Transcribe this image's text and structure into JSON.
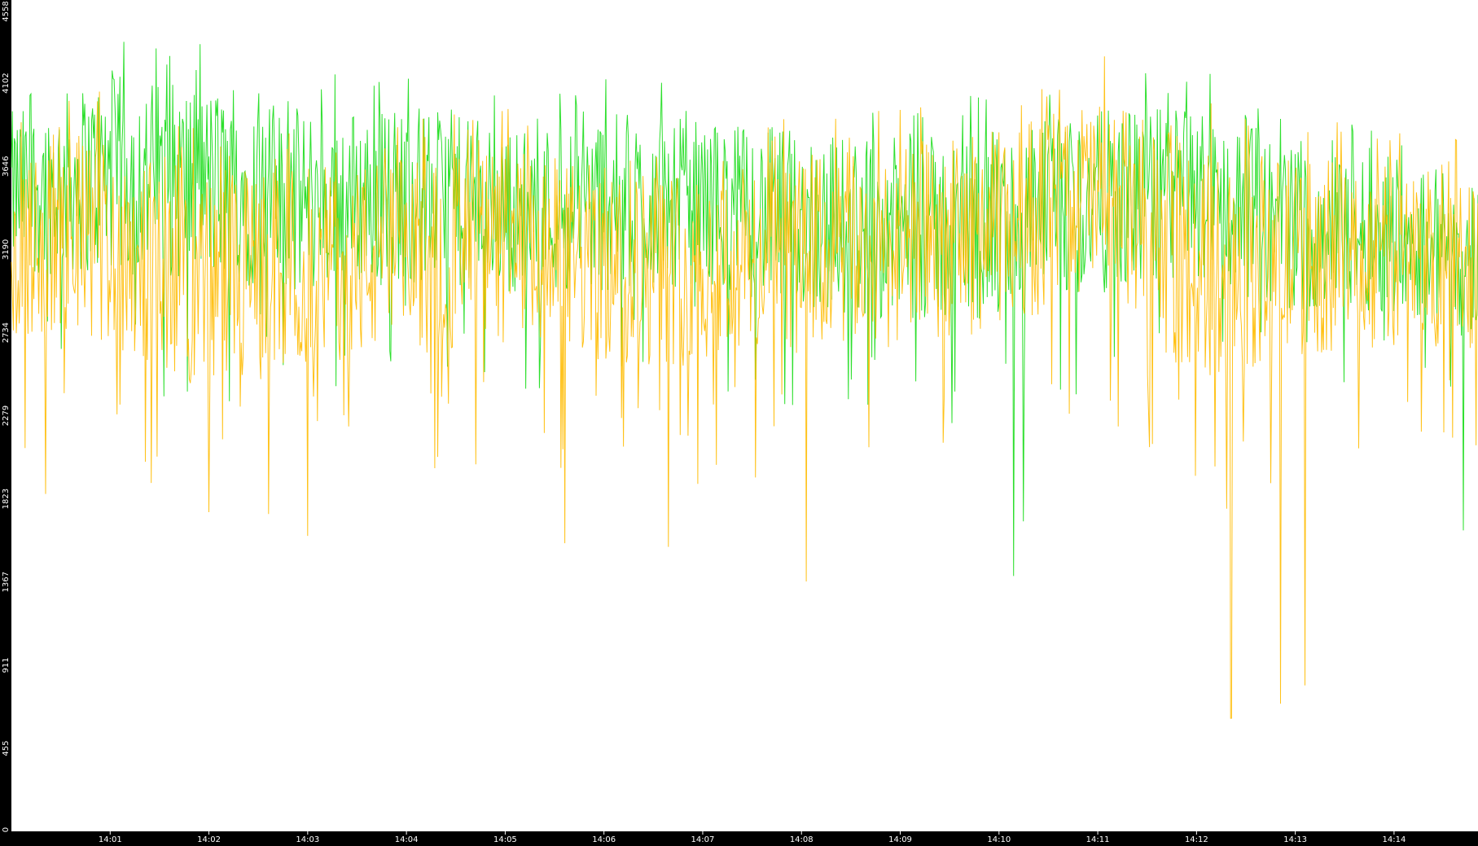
{
  "chart_data": {
    "type": "line",
    "title": "",
    "xlabel": "",
    "ylabel": "",
    "background": "#000000",
    "plot_background": "#ffffff",
    "grid": false,
    "legend": "none",
    "ylim": [
      0,
      4558
    ],
    "yticks": [
      0,
      455,
      911,
      1367,
      1823,
      2279,
      2734,
      3190,
      3646,
      4102,
      4558
    ],
    "xlim_minutes": [
      0,
      14.85
    ],
    "xticks": [
      {
        "label": "14:01",
        "minute": 1
      },
      {
        "label": "14:02",
        "minute": 2
      },
      {
        "label": "14:03",
        "minute": 3
      },
      {
        "label": "14:04",
        "minute": 4
      },
      {
        "label": "14:05",
        "minute": 5
      },
      {
        "label": "14:06",
        "minute": 6
      },
      {
        "label": "14:07",
        "minute": 7
      },
      {
        "label": "14:08",
        "minute": 8
      },
      {
        "label": "14:09",
        "minute": 9
      },
      {
        "label": "14:10",
        "minute": 10
      },
      {
        "label": "14:11",
        "minute": 11
      },
      {
        "label": "14:12",
        "minute": 12
      },
      {
        "label": "14:13",
        "minute": 13
      },
      {
        "label": "14:14",
        "minute": 14
      }
    ],
    "series": [
      {
        "color": "#22dd22",
        "mean": [
          3500,
          3600,
          3550,
          3450,
          3500,
          3400,
          3450,
          3450,
          3350,
          3300,
          3300,
          3450,
          3500,
          3300,
          3300,
          3100
        ],
        "amplitude": [
          450,
          550,
          550,
          500,
          500,
          450,
          500,
          450,
          500,
          500,
          550,
          500,
          500,
          450,
          450,
          450
        ],
        "minima": [
          {
            "minute": 10.15,
            "value": 1400
          },
          {
            "minute": 10.25,
            "value": 1700
          },
          {
            "minute": 14.7,
            "value": 1650
          }
        ]
      },
      {
        "color": "#ffbb00",
        "mean": [
          3200,
          3250,
          3000,
          3100,
          3150,
          3200,
          3100,
          3100,
          3150,
          3200,
          3300,
          3500,
          3100,
          3150,
          3150,
          3150
        ],
        "amplitude": [
          500,
          600,
          600,
          550,
          550,
          550,
          550,
          550,
          550,
          550,
          550,
          550,
          650,
          550,
          500,
          500
        ],
        "minima": [
          {
            "minute": 0.35,
            "value": 1850
          },
          {
            "minute": 2.0,
            "value": 1750
          },
          {
            "minute": 2.6,
            "value": 1740
          },
          {
            "minute": 3.0,
            "value": 1620
          },
          {
            "minute": 5.6,
            "value": 1580
          },
          {
            "minute": 6.65,
            "value": 1560
          },
          {
            "minute": 8.05,
            "value": 1370
          },
          {
            "minute": 12.35,
            "value": 620
          },
          {
            "minute": 12.85,
            "value": 700
          },
          {
            "minute": 13.1,
            "value": 800
          }
        ]
      }
    ]
  }
}
